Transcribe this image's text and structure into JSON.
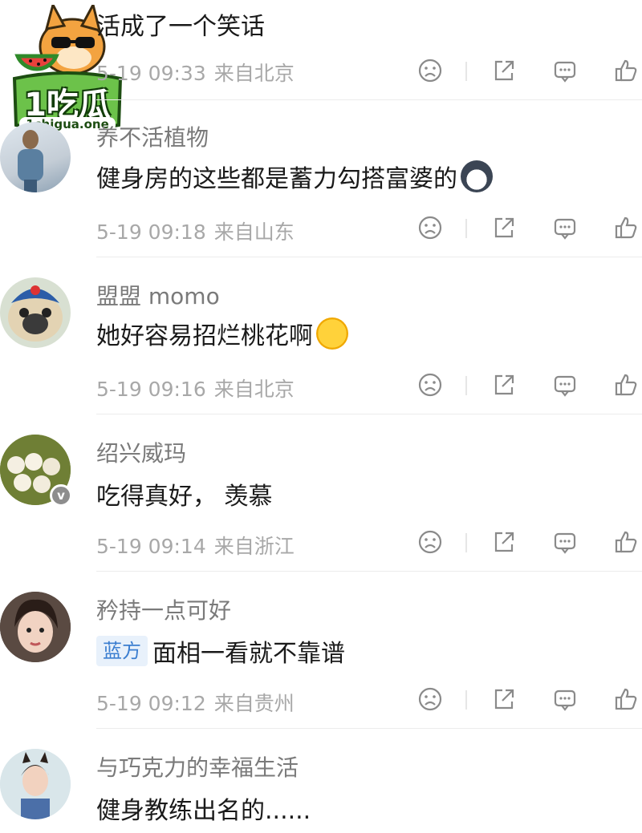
{
  "watermark": {
    "brand": "1吃瓜",
    "site": "1chigua.one"
  },
  "comments": [
    {
      "username": "",
      "text": "活成了一个笑话",
      "time": "5-19 09:33",
      "location": "来自北京"
    },
    {
      "username": "养不活植物",
      "text": "健身房的这些都是蓄力勾搭富婆的",
      "time": "5-19 09:18",
      "location": "来自山东",
      "emoji": "husky-face-emoji"
    },
    {
      "username": "盟盟 momo",
      "text": "她好容易招烂桃花啊",
      "time": "5-19 09:16",
      "location": "来自北京",
      "emoji": "laughing-crying-emoji"
    },
    {
      "username": "绍兴威玛",
      "text": "吃得真好， 羡慕",
      "time": "5-19 09:14",
      "location": "来自浙江",
      "verified": true
    },
    {
      "username": "矜持一点可好",
      "tag": "蓝方",
      "text": "面相一看就不靠谱",
      "time": "5-19 09:12",
      "location": "来自贵州"
    },
    {
      "username": "与巧克力的幸福生活",
      "text": "健身教练出名的......"
    }
  ],
  "icons": {
    "dislike": "frown-face-icon",
    "share": "share-icon",
    "comment": "comment-icon",
    "like": "thumbs-up-icon"
  },
  "colors": {
    "username": "#7a7a7a",
    "body_text": "#1a1a1a",
    "meta": "#a8a8a8",
    "tag_bg": "#e8f1fb",
    "tag_text": "#3b7ed0",
    "icon": "#8a8a8a"
  }
}
